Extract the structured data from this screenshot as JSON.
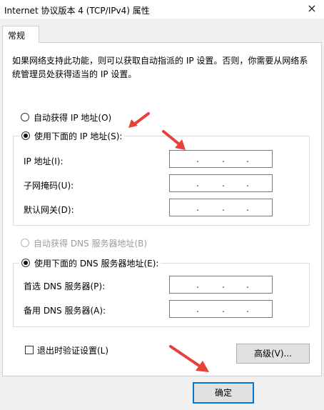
{
  "window": {
    "title": "Internet 协议版本 4 (TCP/IPv4) 属性",
    "close_glyph": "×"
  },
  "tabs": [
    {
      "label": "常规",
      "selected": true
    }
  ],
  "intro_text": "如果网络支持此功能，则可以获取自动指派的 IP 设置。否则，你需要从网络系统管理员处获得适当的 IP 设置。",
  "ip_section": {
    "auto_label": "自动获得 IP 地址(O)",
    "manual_label": "使用下面的 IP 地址(S):",
    "selected": "manual",
    "fields": [
      {
        "label": "IP 地址(I):",
        "value": ". . ."
      },
      {
        "label": "子网掩码(U):",
        "value": ". . ."
      },
      {
        "label": "默认网关(D):",
        "value": ". . ."
      }
    ]
  },
  "dns_section": {
    "auto_label": "自动获得 DNS 服务器地址(B)",
    "auto_disabled": true,
    "manual_label": "使用下面的 DNS 服务器地址(E):",
    "selected": "manual",
    "fields": [
      {
        "label": "首选 DNS 服务器(P):",
        "value": ". . ."
      },
      {
        "label": "备用 DNS 服务器(A):",
        "value": ". . ."
      }
    ]
  },
  "validate_on_exit": {
    "label": "退出时验证设置(L)",
    "checked": false
  },
  "buttons": {
    "advanced": "高级(V)...",
    "ok": "确定"
  },
  "colors": {
    "arrow": "#e8413a",
    "accent": "#0078d7",
    "disabled": "#9c9c9c"
  },
  "annotations": {
    "arrow_icon": "red-arrow-icon",
    "count": 3
  }
}
